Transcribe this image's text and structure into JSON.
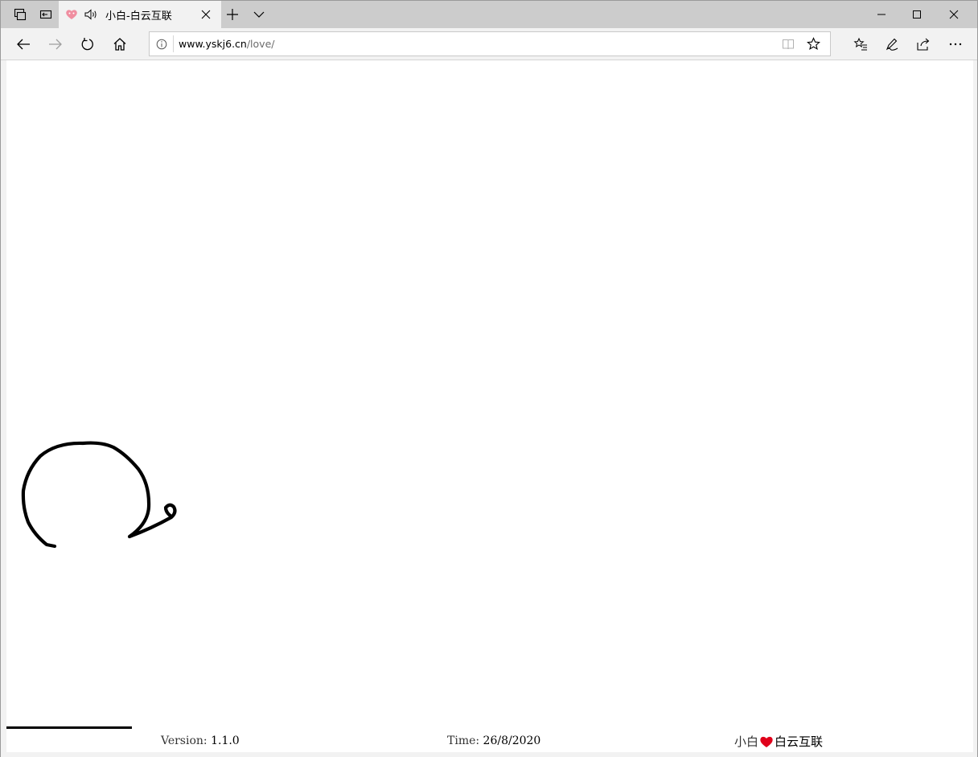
{
  "tab": {
    "title": "小白-白云互联"
  },
  "address_bar": {
    "host": "www.yskj6.cn",
    "path": "/love/"
  },
  "footer": {
    "version_label": "Version:",
    "version_value": "1.1.0",
    "time_label": "Time:",
    "time_value": "26/8/2020",
    "brand_left": "小白",
    "brand_right": "白云互联"
  },
  "icons": {
    "tab_favicon": "heart-icon",
    "tab_audio": "speaker-icon",
    "heart_color": "#e0001b"
  },
  "page": {
    "loading_progress": 0.13
  }
}
